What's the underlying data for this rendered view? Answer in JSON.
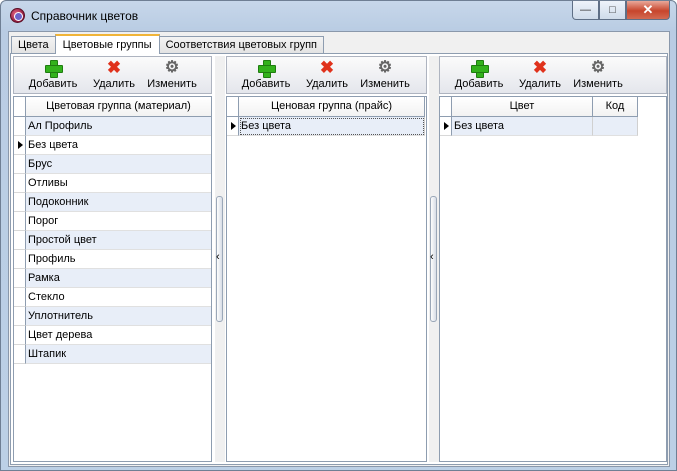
{
  "window": {
    "title": "Справочник цветов",
    "controls": {
      "minimize": "—",
      "maximize": "□",
      "close": "✕"
    }
  },
  "tabs": [
    {
      "label": "Цвета",
      "active": false
    },
    {
      "label": "Цветовые группы",
      "active": true
    },
    {
      "label": "Соответствия цветовых групп",
      "active": false
    }
  ],
  "toolbar": {
    "add": "Добавить",
    "delete": "Удалить",
    "edit": "Изменить"
  },
  "icons": {
    "add": "plus-icon",
    "delete": "cross-icon",
    "edit": "gear-icon",
    "splitter": "chevron-left-icon"
  },
  "panels": {
    "material": {
      "columns": [
        "Цветовая группа (материал)"
      ],
      "rows": [
        "Ал Профиль",
        "Без цвета",
        "Брус",
        "Отливы",
        "Подоконник",
        "Порог",
        "Простой цвет",
        "Профиль",
        "Рамка",
        "Стекло",
        "Уплотнитель",
        "Цвет дерева",
        "Штапик"
      ],
      "current_row": "Без цвета"
    },
    "price": {
      "columns": [
        "Ценовая группа (прайс)"
      ],
      "rows": [
        "Без цвета"
      ],
      "current_row": "Без цвета"
    },
    "colors": {
      "columns": [
        "Цвет",
        "Код"
      ],
      "rows": [
        [
          "Без цвета",
          ""
        ]
      ],
      "current_row": "Без цвета"
    }
  },
  "colors": {
    "row_alt": "#e8eef8",
    "add_green": "#33b21c",
    "delete_red": "#e0321c",
    "active_tab_accent": "#f0b438"
  }
}
